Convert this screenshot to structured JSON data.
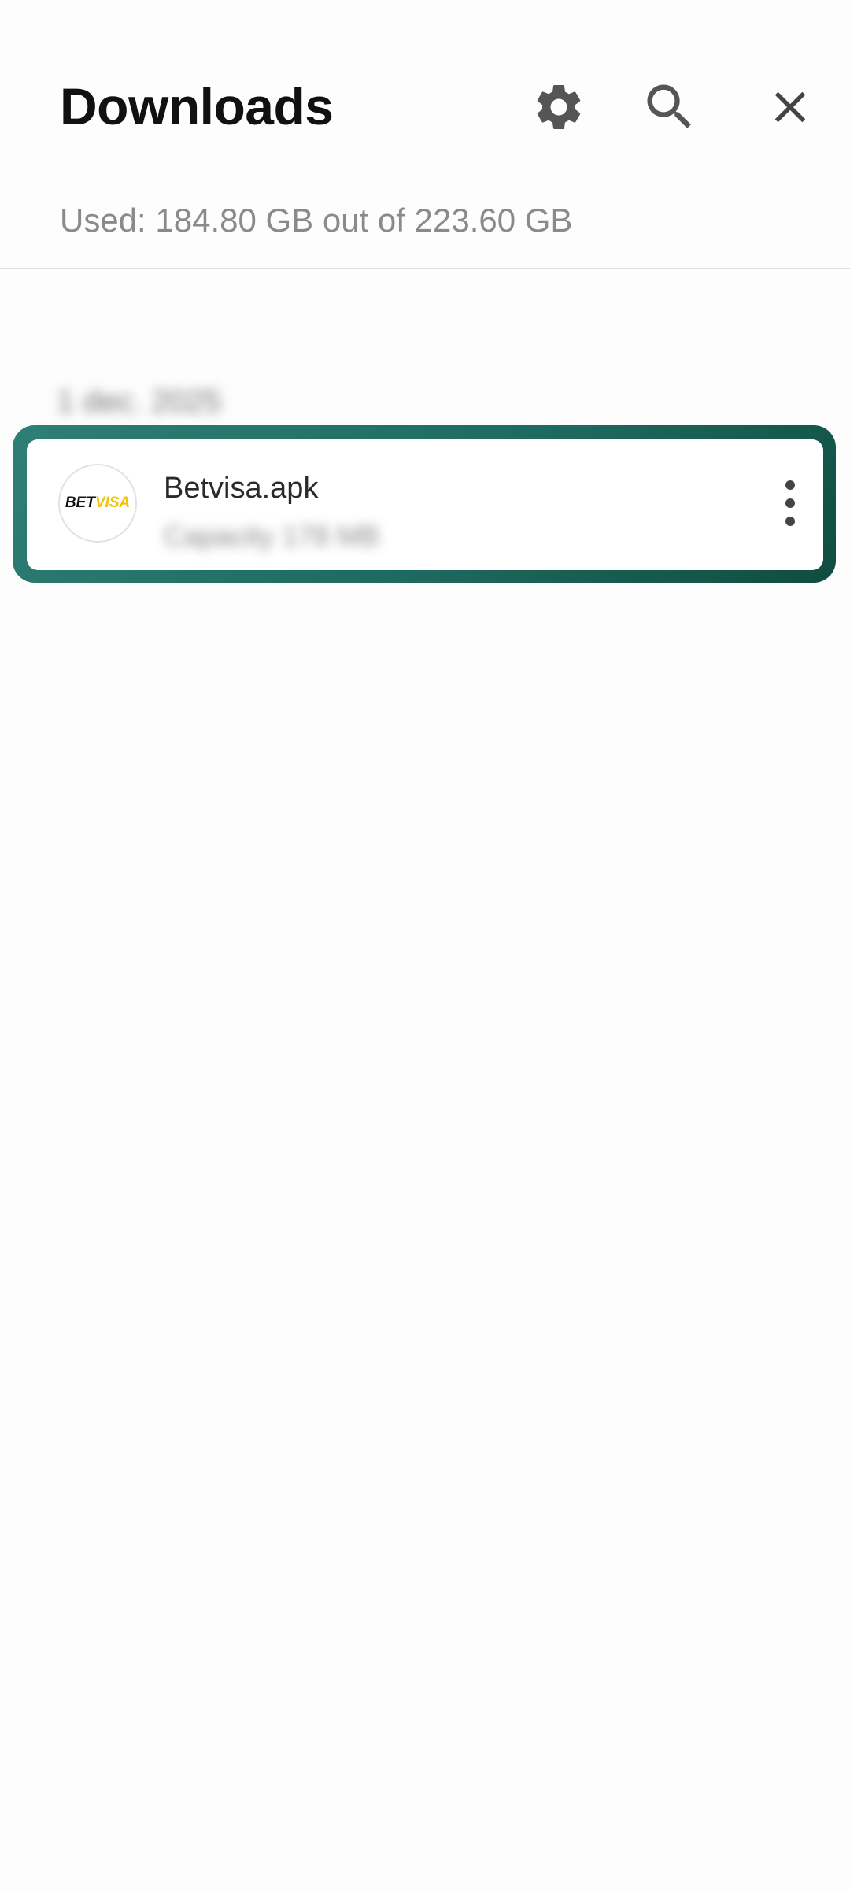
{
  "header": {
    "title": "Downloads",
    "storage_text": "Used: 184.80 GB out of 223.60 GB"
  },
  "icons": {
    "settings": "gear-icon",
    "search": "search-icon",
    "close": "close-icon",
    "more": "more-vertical-icon"
  },
  "list": {
    "date_header": "1 dec. 2025",
    "items": [
      {
        "name": "Betvisa.apk",
        "meta": "Capacity 178 MB",
        "thumb_logo_left": "BET",
        "thumb_logo_right": "VISA"
      }
    ]
  },
  "colors": {
    "highlight_border": "#1f6a5f",
    "logo_accent": "#f2c300",
    "icon_gray": "#555555"
  }
}
